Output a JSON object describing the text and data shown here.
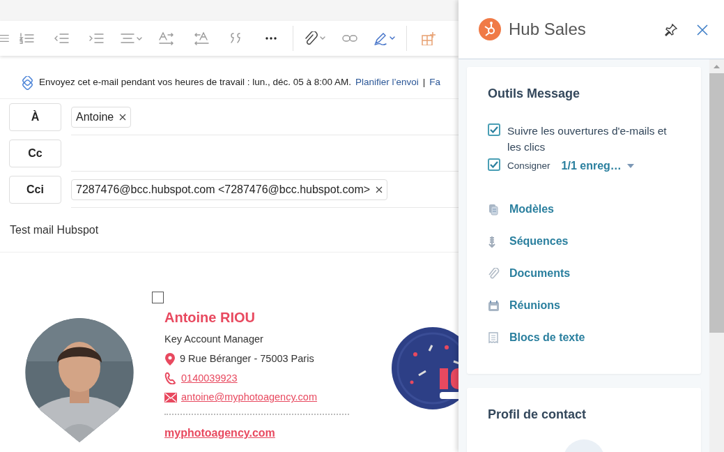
{
  "schedule_tip": {
    "text": "Envoyez cet e-mail pendant vos heures de travail : lun., déc. 05 à 8:00 AM.",
    "link": "Planifier l’envoi",
    "separator": "|",
    "cut_link": "Fa"
  },
  "recipients": [
    {
      "label": "À",
      "chips": [
        "Antoine"
      ]
    },
    {
      "label": "Cc"
    },
    {
      "label": "Cci",
      "chips": [
        "7287476@bcc.hubspot.com <7287476@bcc.hubspot.com>"
      ]
    }
  ],
  "subject": "Test mail Hubspot",
  "signature": {
    "name": "Antoine RIOU",
    "title": "Key Account Manager",
    "address": "9 Rue Béranger - 75003 Paris",
    "phone": "0140039923",
    "email": "antoine@myphotoagency.com",
    "website": "myphotoagency.com"
  },
  "panel": {
    "title": "Hub Sales",
    "tools": {
      "title": "Outils Message",
      "checks": [
        {
          "label": "Suivre les ouvertures d'e-mails et les clics",
          "checked": true
        },
        {
          "label": "Consigner",
          "checked": true,
          "value": "1/1 enreg…"
        }
      ],
      "links": [
        {
          "label": "Modèles",
          "kind": "templates"
        },
        {
          "label": "Séquences",
          "kind": "sequences"
        },
        {
          "label": "Documents",
          "kind": "documents"
        },
        {
          "label": "Réunions",
          "kind": "meetings"
        },
        {
          "label": "Blocs de texte",
          "kind": "snippets"
        }
      ]
    },
    "contact": {
      "title": "Profil de contact"
    }
  }
}
